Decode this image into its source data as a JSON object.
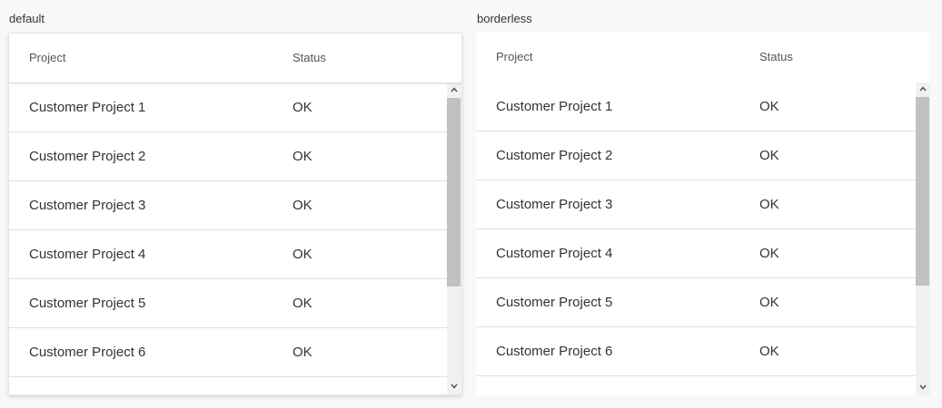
{
  "variants": [
    {
      "label": "default",
      "columns": {
        "project": "Project",
        "status": "Status"
      },
      "rows": [
        {
          "project": "Customer Project 1",
          "status": "OK"
        },
        {
          "project": "Customer Project 2",
          "status": "OK"
        },
        {
          "project": "Customer Project 3",
          "status": "OK"
        },
        {
          "project": "Customer Project 4",
          "status": "OK"
        },
        {
          "project": "Customer Project 5",
          "status": "OK"
        },
        {
          "project": "Customer Project 6",
          "status": "OK"
        }
      ]
    },
    {
      "label": "borderless",
      "columns": {
        "project": "Project",
        "status": "Status"
      },
      "rows": [
        {
          "project": "Customer Project 1",
          "status": "OK"
        },
        {
          "project": "Customer Project 2",
          "status": "OK"
        },
        {
          "project": "Customer Project 3",
          "status": "OK"
        },
        {
          "project": "Customer Project 4",
          "status": "OK"
        },
        {
          "project": "Customer Project 5",
          "status": "OK"
        },
        {
          "project": "Customer Project 6",
          "status": "OK"
        }
      ]
    }
  ],
  "colors": {
    "background": "#f8f8f8",
    "grid_background": "#ffffff",
    "row_divider": "#e0e0e0",
    "scrollbar_thumb": "#c1c1c1",
    "scrollbar_track": "#f1f1f1"
  },
  "icons": {
    "scroll_up": "chevron-up-icon",
    "scroll_down": "chevron-down-icon"
  }
}
